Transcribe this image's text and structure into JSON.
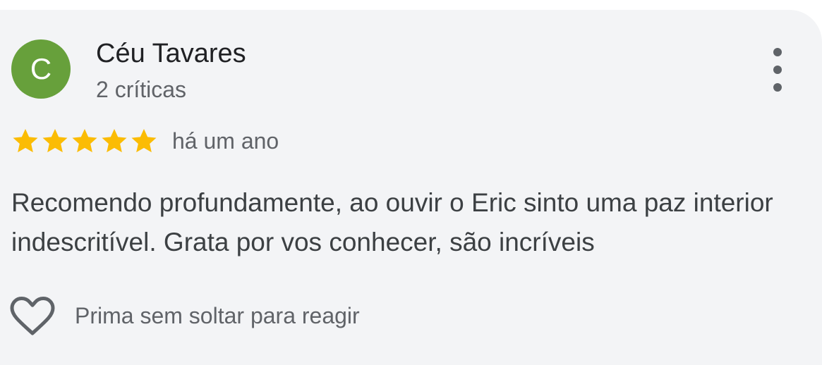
{
  "review": {
    "author": {
      "initial": "C",
      "name": "Céu Tavares",
      "meta": "2 críticas",
      "avatar_color": "#67a03b"
    },
    "rating": {
      "value": 5,
      "max": 5,
      "star_color": "#fbbc04"
    },
    "time": "há um ano",
    "text": "Recomendo profundamente, ao ouvir o Eric sinto uma paz interior indescritível. Grata por vos conhecer, são incríveis",
    "reaction": {
      "icon": "heart-outline-icon",
      "label": "Prima sem soltar para reagir"
    },
    "menu_icon": "more-vert-icon"
  }
}
